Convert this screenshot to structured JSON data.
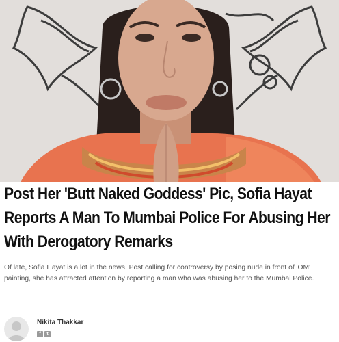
{
  "article": {
    "headline": "Post Her 'Butt Naked Goddess' Pic, Sofia Hayat Reports A Man To Mumbai Police For Abusing Her With Derogatory Remarks",
    "summary": "Of late, Sofia Hayat is a lot in the news. Post calling for controversy by posing nude in front of 'OM' painting, she has attracted attention by reporting a man who was abusing her to the Mumbai Police."
  },
  "author": {
    "name": "Nikita Thakkar",
    "social_icons": [
      "facebook-icon",
      "twitter-icon"
    ]
  },
  "colors": {
    "headline": "#111111",
    "summary": "#555555",
    "saree": "#e8734f",
    "hair": "#2a1f1c"
  }
}
